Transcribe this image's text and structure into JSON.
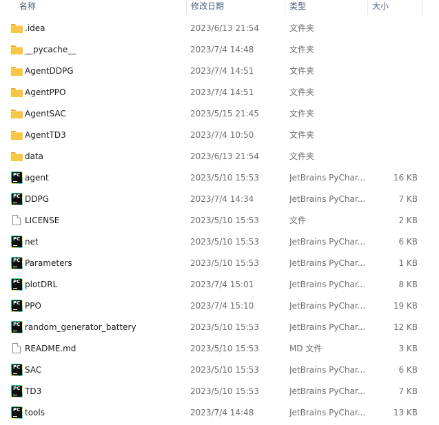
{
  "columns": {
    "name": "名称",
    "date": "修改日期",
    "type": "类型",
    "size": "大小"
  },
  "files": [
    {
      "name": ".idea",
      "date": "2023/6/13 21:54",
      "type": "文件夹",
      "size": "",
      "icon": "folder-icon"
    },
    {
      "name": "__pycache__",
      "date": "2023/7/4 14:48",
      "type": "文件夹",
      "size": "",
      "icon": "folder-icon"
    },
    {
      "name": "AgentDDPG",
      "date": "2023/7/4 14:51",
      "type": "文件夹",
      "size": "",
      "icon": "folder-icon"
    },
    {
      "name": "AgentPPO",
      "date": "2023/7/4 14:51",
      "type": "文件夹",
      "size": "",
      "icon": "folder-icon"
    },
    {
      "name": "AgentSAC",
      "date": "2023/5/15 21:45",
      "type": "文件夹",
      "size": "",
      "icon": "folder-icon"
    },
    {
      "name": "AgentTD3",
      "date": "2023/7/4 10:50",
      "type": "文件夹",
      "size": "",
      "icon": "folder-icon"
    },
    {
      "name": "data",
      "date": "2023/6/13 21:54",
      "type": "文件夹",
      "size": "",
      "icon": "folder-icon"
    },
    {
      "name": "agent",
      "date": "2023/5/10 15:53",
      "type": "JetBrains PyChar...",
      "size": "16 KB",
      "icon": "pycharm-file-icon"
    },
    {
      "name": "DDPG",
      "date": "2023/7/4 14:34",
      "type": "JetBrains PyChar...",
      "size": "7 KB",
      "icon": "pycharm-file-icon"
    },
    {
      "name": "LICENSE",
      "date": "2023/5/10 15:53",
      "type": "文件",
      "size": "2 KB",
      "icon": "blank-file-icon"
    },
    {
      "name": "net",
      "date": "2023/5/10 15:53",
      "type": "JetBrains PyChar...",
      "size": "6 KB",
      "icon": "pycharm-file-icon"
    },
    {
      "name": "Parameters",
      "date": "2023/5/10 15:53",
      "type": "JetBrains PyChar...",
      "size": "1 KB",
      "icon": "pycharm-file-icon"
    },
    {
      "name": "plotDRL",
      "date": "2023/7/4 15:01",
      "type": "JetBrains PyChar...",
      "size": "8 KB",
      "icon": "pycharm-file-icon"
    },
    {
      "name": "PPO",
      "date": "2023/7/4 15:10",
      "type": "JetBrains PyChar...",
      "size": "19 KB",
      "icon": "pycharm-file-icon"
    },
    {
      "name": "random_generator_battery",
      "date": "2023/5/10 15:53",
      "type": "JetBrains PyChar...",
      "size": "12 KB",
      "icon": "pycharm-file-icon"
    },
    {
      "name": "README.md",
      "date": "2023/5/10 15:53",
      "type": "MD 文件",
      "size": "3 KB",
      "icon": "blank-file-icon"
    },
    {
      "name": "SAC",
      "date": "2023/5/10 15:53",
      "type": "JetBrains PyChar...",
      "size": "6 KB",
      "icon": "pycharm-file-icon"
    },
    {
      "name": "TD3",
      "date": "2023/5/10 15:53",
      "type": "JetBrains PyChar...",
      "size": "7 KB",
      "icon": "pycharm-file-icon"
    },
    {
      "name": "tools",
      "date": "2023/7/4 14:48",
      "type": "JetBrains PyChar...",
      "size": "13 KB",
      "icon": "pycharm-file-icon"
    }
  ]
}
